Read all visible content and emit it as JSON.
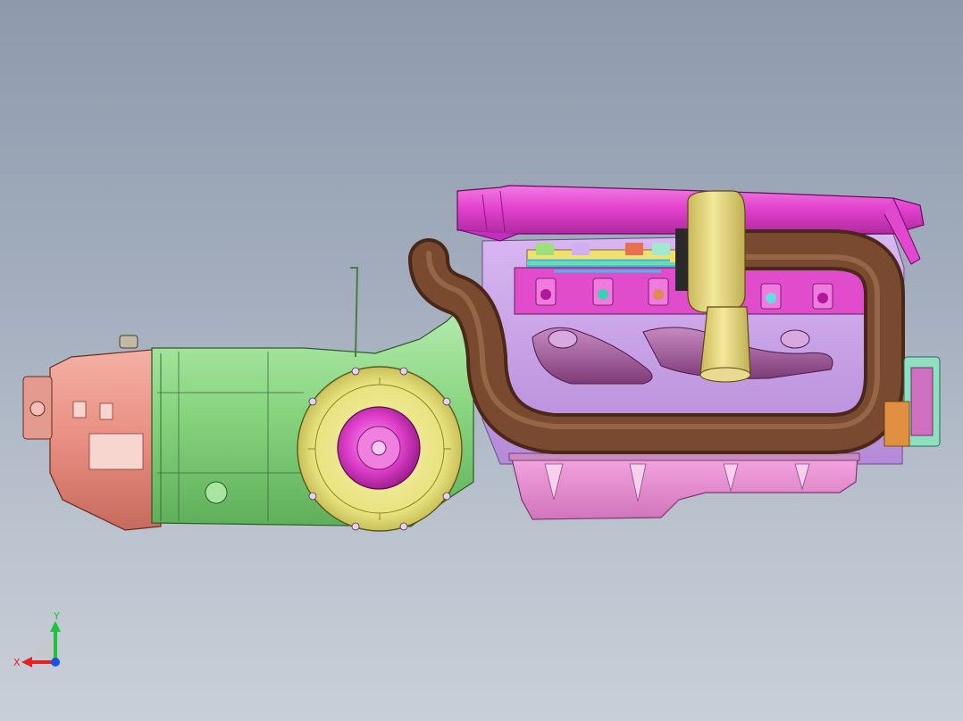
{
  "viewport": {
    "background_top": "#8e9aac",
    "background_bottom": "#c9cfd8"
  },
  "model": {
    "parts": [
      {
        "name": "transfer-case",
        "color": "#e9958a"
      },
      {
        "name": "transmission-housing",
        "color": "#8fd68a"
      },
      {
        "name": "flywheel",
        "color": "#ecea8c"
      },
      {
        "name": "clutch-hub",
        "color": "#e24ed0"
      },
      {
        "name": "intake-plenum",
        "color": "#e33fd0"
      },
      {
        "name": "exhaust-pipe",
        "color": "#6d3f2a"
      },
      {
        "name": "turbocharger",
        "color": "#e5d77a"
      },
      {
        "name": "exhaust-manifold",
        "color": "#9b5a96"
      },
      {
        "name": "oil-pan",
        "color": "#e98bd0"
      },
      {
        "name": "engine-block",
        "color": "#c8a0e8"
      },
      {
        "name": "pulley",
        "color": "#8fe0c0"
      }
    ]
  },
  "triad": {
    "x_label": "X",
    "y_label": "Y",
    "x_color": "#e82020",
    "y_color": "#20c040",
    "z_color": "#2050e0"
  }
}
